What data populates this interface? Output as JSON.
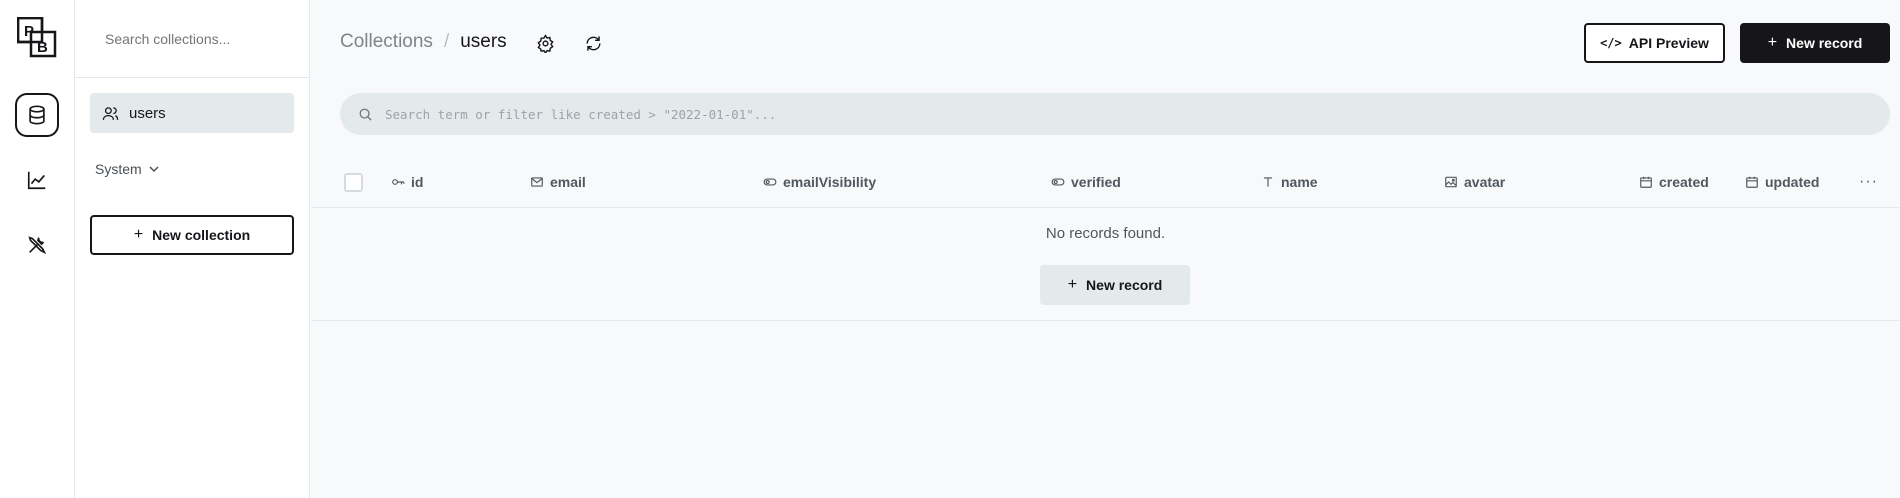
{
  "logo": {
    "letter_top": "P",
    "letter_bottom": "B"
  },
  "rail": {
    "items": [
      {
        "icon": "database-icon",
        "active": true
      },
      {
        "icon": "chart-line-icon",
        "active": false
      },
      {
        "icon": "tools-icon",
        "active": false
      }
    ]
  },
  "sidebar": {
    "search_placeholder": "Search collections...",
    "collections": [
      {
        "label": "users",
        "icon": "users-icon"
      }
    ],
    "system_label": "System",
    "new_collection_label": "New collection"
  },
  "header": {
    "breadcrumb_root": "Collections",
    "breadcrumb_sep": "/",
    "breadcrumb_current": "users",
    "api_preview_icon": "</>",
    "api_preview_label": "API Preview",
    "new_record_label": "New record"
  },
  "search": {
    "placeholder": "Search term or filter like created > \"2022-01-01\"..."
  },
  "table": {
    "columns": [
      {
        "label": "id",
        "icon": "key-icon"
      },
      {
        "label": "email",
        "icon": "mail-icon"
      },
      {
        "label": "emailVisibility",
        "icon": "toggle-icon"
      },
      {
        "label": "verified",
        "icon": "toggle-icon"
      },
      {
        "label": "name",
        "icon": "text-icon"
      },
      {
        "label": "avatar",
        "icon": "image-icon"
      },
      {
        "label": "created",
        "icon": "calendar-icon"
      },
      {
        "label": "updated",
        "icon": "calendar-icon"
      }
    ],
    "more_label": "···",
    "empty_text": "No records found.",
    "empty_button_label": "New record"
  },
  "plus_glyph": "+"
}
